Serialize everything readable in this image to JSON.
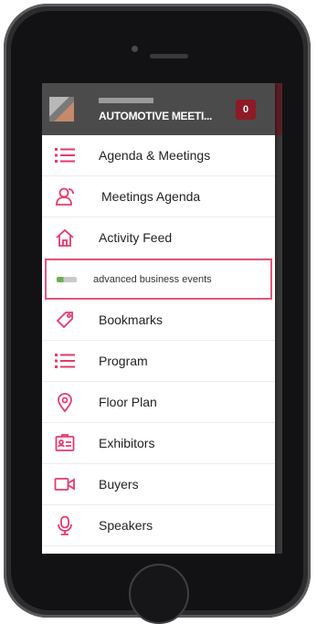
{
  "colors": {
    "accent": "#e6396b",
    "header_bg": "#4b4b4b",
    "badge_bg": "#8e1a28",
    "highlight_border": "#e2557a"
  },
  "header": {
    "title": "AUTOMOTIVE MEETI...",
    "badge": "0"
  },
  "menu": {
    "items": [
      {
        "label": "Agenda & Meetings",
        "icon": "list-icon"
      },
      {
        "label": "Meetings Agenda",
        "icon": "users-icon"
      },
      {
        "label": "Activity Feed",
        "icon": "home-icon"
      },
      {
        "label": "advanced business events",
        "icon": "logo-icon",
        "highlighted": true
      },
      {
        "label": "Bookmarks",
        "icon": "tag-icon"
      },
      {
        "label": "Program",
        "icon": "list-icon"
      },
      {
        "label": "Floor Plan",
        "icon": "location-pin-icon"
      },
      {
        "label": "Exhibitors",
        "icon": "id-card-icon"
      },
      {
        "label": "Buyers",
        "icon": "video-camera-icon"
      },
      {
        "label": "Speakers",
        "icon": "microphone-icon"
      }
    ]
  }
}
